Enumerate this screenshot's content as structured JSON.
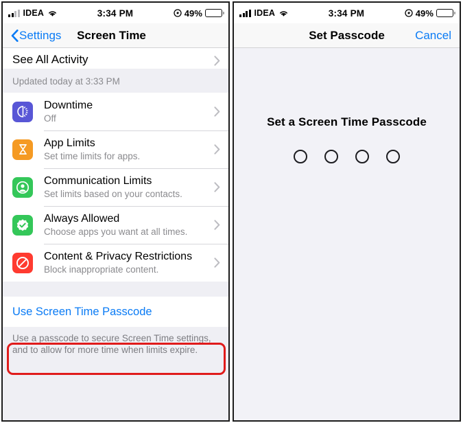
{
  "left_phone": {
    "status_bar": {
      "carrier": "IDEA",
      "signal_icon": "cellular-signal-icon",
      "signal_bars_active": 2,
      "wifi_icon": "wifi-icon",
      "time": "3:34 PM",
      "location_icon": "location-services-icon",
      "battery_percent": "49%",
      "battery_icon": "battery-icon",
      "battery_level": 49
    },
    "nav": {
      "back_label": "Settings",
      "back_icon": "chevron-left-icon",
      "title": "Screen Time"
    },
    "see_all_activity": {
      "label": "See All Activity",
      "chevron_icon": "chevron-right-icon"
    },
    "updated_header": "Updated today at 3:33 PM",
    "rows": [
      {
        "title": "Downtime",
        "subtitle": "Off",
        "icon_name": "downtime-icon",
        "icon_color": "#5856d6",
        "chevron_icon": "chevron-right-icon"
      },
      {
        "title": "App Limits",
        "subtitle": "Set time limits for apps.",
        "icon_name": "hourglass-icon",
        "icon_color": "#f59a23",
        "chevron_icon": "chevron-right-icon"
      },
      {
        "title": "Communication Limits",
        "subtitle": "Set limits based on your contacts.",
        "icon_name": "person-circle-icon",
        "icon_color": "#34c759",
        "chevron_icon": "chevron-right-icon"
      },
      {
        "title": "Always Allowed",
        "subtitle": "Choose apps you want at all times.",
        "icon_name": "checkmark-seal-icon",
        "icon_color": "#34c759",
        "chevron_icon": "chevron-right-icon"
      },
      {
        "title": "Content & Privacy Restrictions",
        "subtitle": "Block inappropriate content.",
        "icon_name": "prohibited-icon",
        "icon_color": "#ff3b30",
        "chevron_icon": "chevron-right-icon"
      }
    ],
    "passcode_link": "Use Screen Time Passcode",
    "passcode_footer": "Use a passcode to secure Screen Time settings, and to allow for more time when limits expire.",
    "highlight_color": "#e01b1b"
  },
  "right_phone": {
    "status_bar": {
      "carrier": "IDEA",
      "signal_icon": "cellular-signal-icon",
      "signal_bars_active": 4,
      "wifi_icon": "wifi-icon",
      "time": "3:34 PM",
      "location_icon": "location-services-icon",
      "battery_percent": "49%",
      "battery_icon": "battery-icon",
      "battery_level": 49
    },
    "nav": {
      "title": "Set Passcode",
      "cancel_label": "Cancel"
    },
    "prompt": "Set a Screen Time Passcode",
    "passcode_dots": [
      false,
      false,
      false,
      false
    ]
  },
  "theme": {
    "accent_blue": "#0a7bf5",
    "group_bg": "#efeff4",
    "passcode_bg": "#f2f2f7",
    "separator": "#d6d6da"
  }
}
